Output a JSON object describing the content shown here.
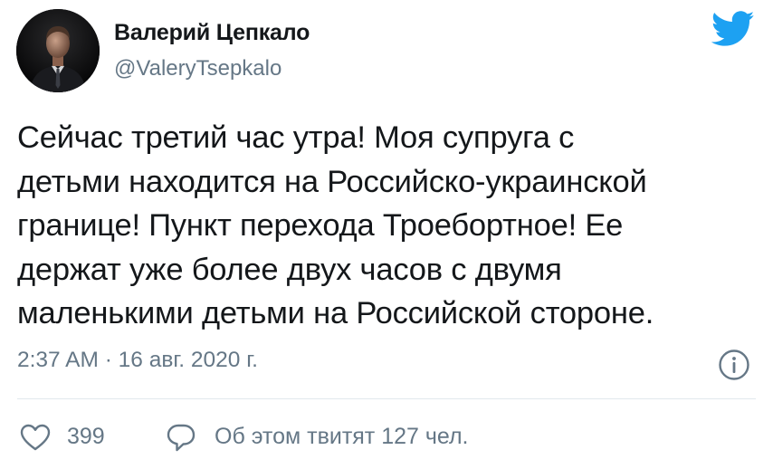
{
  "author": {
    "display_name": "Валерий Цепкало",
    "handle": "@ValeryTsepkalo",
    "avatar": "avatar-photo"
  },
  "brand": {
    "icon": "twitter-bird-icon",
    "color": "#1da1f2"
  },
  "tweet": {
    "lines": [
      "Сейчас третий час утра! Моя супруга с",
      "детьми находится на Российско-украинской",
      "границе! Пункт перехода Троебортное! Ее",
      "держат уже более двух часов с двумя",
      "маленькими детьми на Российской стороне."
    ],
    "timestamp": "2:37 AM · 16 авг. 2020 г."
  },
  "actions": {
    "like_icon": "heart-icon",
    "like_count": "399",
    "reply_icon": "speech-bubble-icon",
    "discussion_text": "Об этом твитят 127 чел."
  },
  "info": {
    "icon": "info-icon"
  },
  "colors": {
    "text": "#14171a",
    "secondary": "#657786",
    "divider": "#e1e8ed",
    "accent": "#1da1f2"
  }
}
